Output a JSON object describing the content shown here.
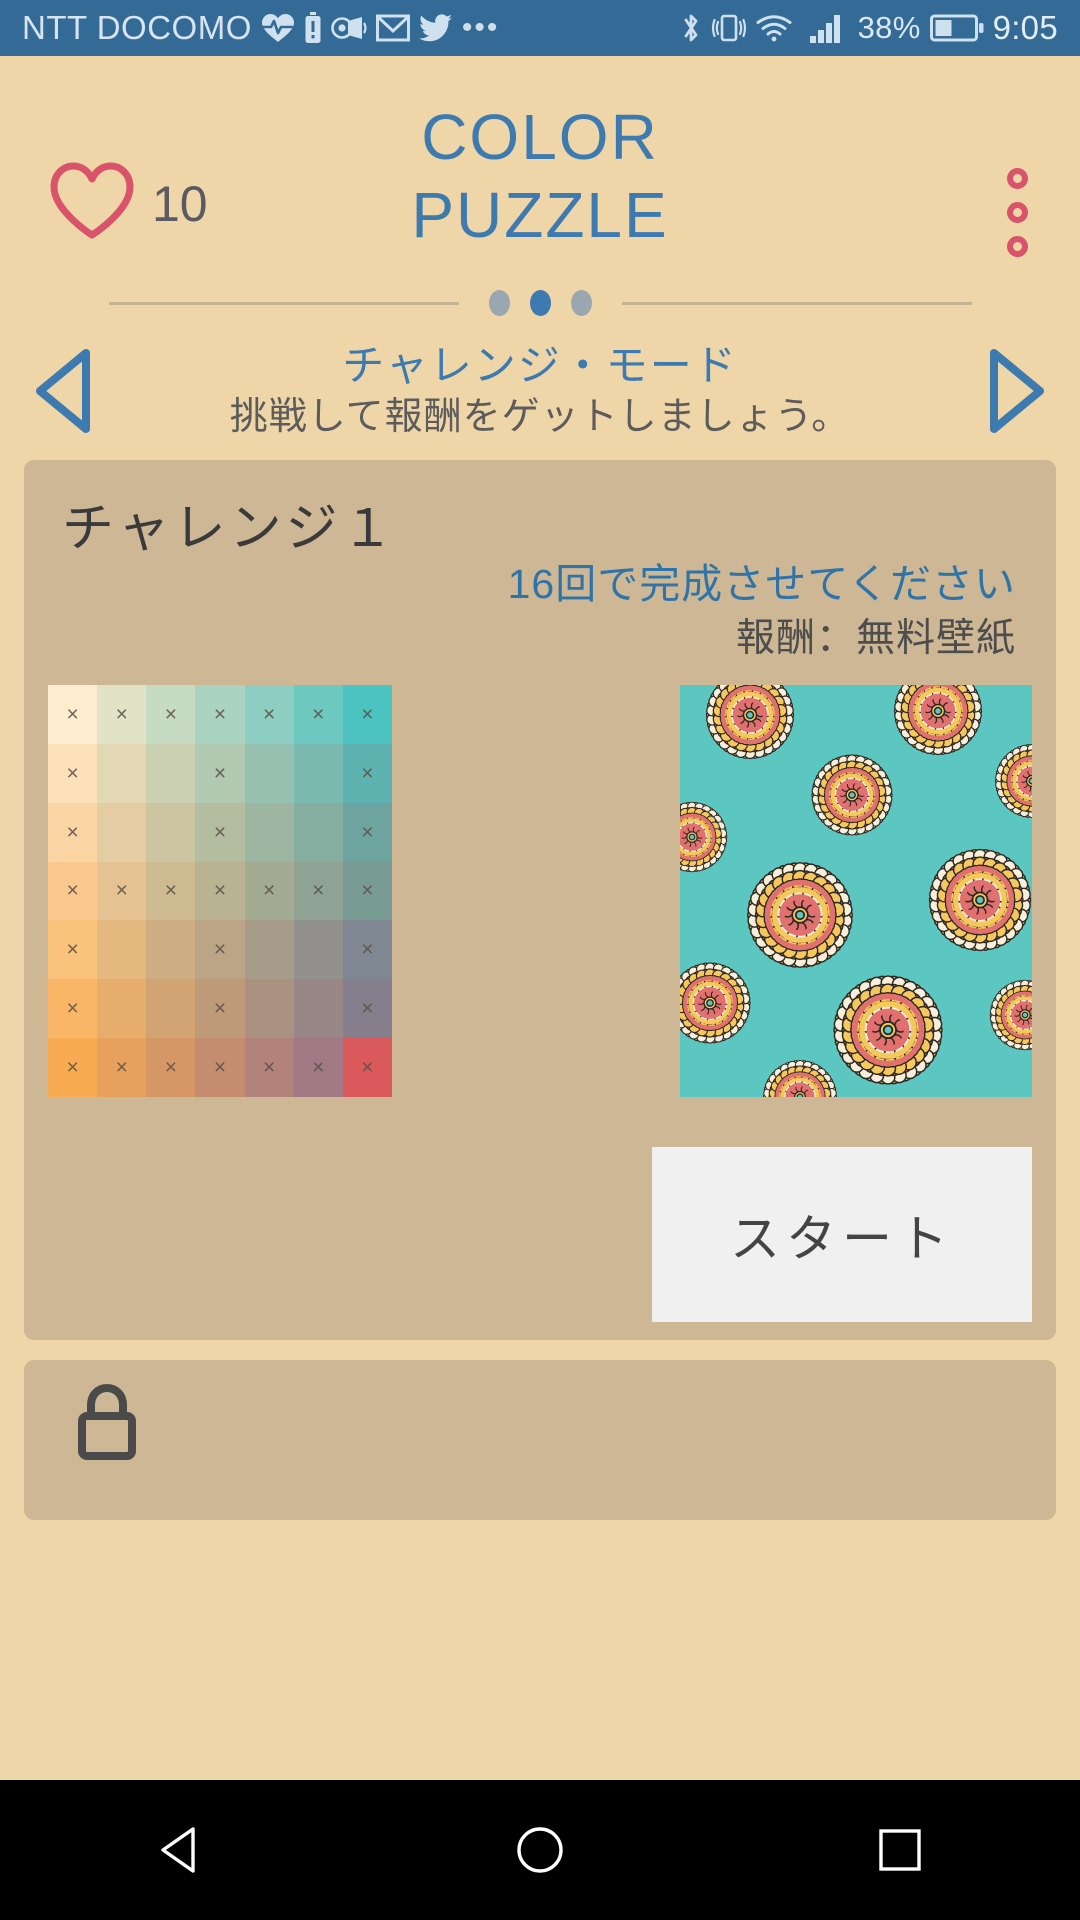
{
  "status_bar": {
    "carrier": "NTT DOCOMO",
    "left_icons": [
      "heart-pulse-icon",
      "battery-alert-icon",
      "volume-icon",
      "mail-icon",
      "twitter-icon",
      "more-icon"
    ],
    "right_icons": [
      "bluetooth-icon",
      "vibrate-icon",
      "wifi-icon",
      "signal-icon"
    ],
    "battery_percent": "38%",
    "time": "9:05",
    "background_color": "#336b96",
    "text_color": "#d8e4ef"
  },
  "header": {
    "lives_icon": "heart-outline-icon",
    "lives_count": "10",
    "title_line1": "COLOR",
    "title_line2": "PUZZLE",
    "title_color": "#3d7ab0",
    "overflow_icon": "overflow-menu-icon",
    "overflow_color": "#d9536b"
  },
  "pager": {
    "dots": [
      {
        "active": false
      },
      {
        "active": true
      },
      {
        "active": false
      }
    ],
    "active_color": "#3d7ab0",
    "inactive_color": "#9aa6b0"
  },
  "mode": {
    "prev_icon": "chevron-left-icon",
    "next_icon": "chevron-right-icon",
    "title": "チャレンジ・モード",
    "subtitle": "挑戦して報酬をゲットしましょう。"
  },
  "challenge_card": {
    "title": "チャレンジ１",
    "goal": "16回で完成させてください",
    "reward": "報酬：無料壁紙",
    "start_label": "スタート",
    "background_color": "#cdb794",
    "preview_label": "wallpaper-preview"
  },
  "locked_card": {
    "lock_icon": "lock-icon"
  },
  "nav_bar": {
    "back_icon": "triangle-back-icon",
    "home_icon": "circle-home-icon",
    "recents_icon": "square-recents-icon"
  },
  "chart_data": {
    "type": "heatmap",
    "title": "Color Puzzle 7x7 gradient board",
    "rows": 7,
    "cols": 7,
    "corner_colors": {
      "top_left": "#fdeccd",
      "top_right": "#4cc3c0",
      "bottom_left": "#f9c66a",
      "bottom_right": "#d9595c"
    },
    "grid_colors": [
      [
        "#fdeccd",
        "#e0e3c6",
        "#c7dbc2",
        "#abd3c2",
        "#8ecdc1",
        "#6dc8c0",
        "#4cc3c0"
      ],
      [
        "#fce0b8",
        "#e3d8b4",
        "#cbd0b2",
        "#b1c8b1",
        "#96c1b1",
        "#7abab0",
        "#5eb3b0"
      ],
      [
        "#fbd5a4",
        "#e4cda3",
        "#cdc5a2",
        "#b5bda1",
        "#9db6a1",
        "#85ada0",
        "#6ea4a0"
      ],
      [
        "#fbc98f",
        "#e5c291",
        "#cfbb92",
        "#b9b392",
        "#a4ab93",
        "#8ea393",
        "#789c93"
      ],
      [
        "#fac27b",
        "#e5b87f",
        "#d0ae83",
        "#bca587",
        "#a79b8a",
        "#92918e",
        "#7e8792"
      ],
      [
        "#fab667",
        "#e6ad6d",
        "#d2a373",
        "#bf9a79",
        "#ab9180",
        "#988786",
        "#857e8c"
      ],
      [
        "#f9ab52",
        "#e8a15c",
        "#d69766",
        "#c48d70",
        "#b2837a",
        "#a07984",
        "#d9595c"
      ]
    ],
    "marked_cells": [
      [
        0,
        0
      ],
      [
        0,
        1
      ],
      [
        0,
        2
      ],
      [
        0,
        3
      ],
      [
        0,
        4
      ],
      [
        0,
        5
      ],
      [
        0,
        6
      ],
      [
        1,
        0
      ],
      [
        1,
        3
      ],
      [
        1,
        6
      ],
      [
        2,
        0
      ],
      [
        2,
        3
      ],
      [
        2,
        6
      ],
      [
        3,
        0
      ],
      [
        3,
        1
      ],
      [
        3,
        2
      ],
      [
        3,
        3
      ],
      [
        3,
        4
      ],
      [
        3,
        5
      ],
      [
        3,
        6
      ],
      [
        4,
        0
      ],
      [
        4,
        3
      ],
      [
        4,
        6
      ],
      [
        5,
        0
      ],
      [
        5,
        3
      ],
      [
        5,
        6
      ],
      [
        6,
        0
      ],
      [
        6,
        1
      ],
      [
        6,
        2
      ],
      [
        6,
        3
      ],
      [
        6,
        4
      ],
      [
        6,
        5
      ],
      [
        6,
        6
      ]
    ],
    "mark_glyph": "×"
  }
}
